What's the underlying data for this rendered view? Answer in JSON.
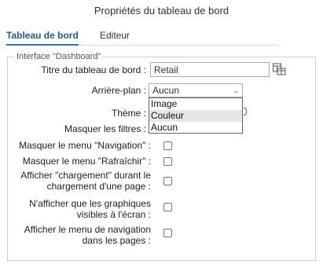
{
  "dialog": {
    "title": "Propriétés du tableau de bord"
  },
  "tabs": [
    {
      "label": "Tableau de bord"
    },
    {
      "label": "Editeur"
    }
  ],
  "section": {
    "legend": "Interface \"Dashboard\"",
    "title_field": {
      "label": "Titre du tableau de bord :",
      "value": "Retail"
    },
    "background": {
      "label": "Arrière-plan :",
      "selected": "Aucun",
      "options": [
        "Image",
        "Couleur",
        "Aucun"
      ],
      "highlighted": "Couleur"
    },
    "theme": {
      "label": "Thème :"
    },
    "hide_filters": {
      "label": "Masquer les filtres :"
    },
    "checkboxes": [
      {
        "label": "Masquer le menu \"Navigation\" :",
        "checked": false
      },
      {
        "label": "Masquer le menu \"Rafraîchir\" :",
        "checked": false
      },
      {
        "line1": "Afficher \"chargement\" durant le",
        "line2": "chargement d'une page :",
        "checked": false
      },
      {
        "line1": "N'afficher que les graphiques",
        "line2": "visibles à l'écran :",
        "checked": false
      },
      {
        "line1": "Afficher le menu de navigation",
        "line2": "dans les pages :",
        "checked": false
      }
    ]
  },
  "icons": {
    "expression": "expression-builder-icon",
    "chevron": "chevron-down-icon"
  }
}
